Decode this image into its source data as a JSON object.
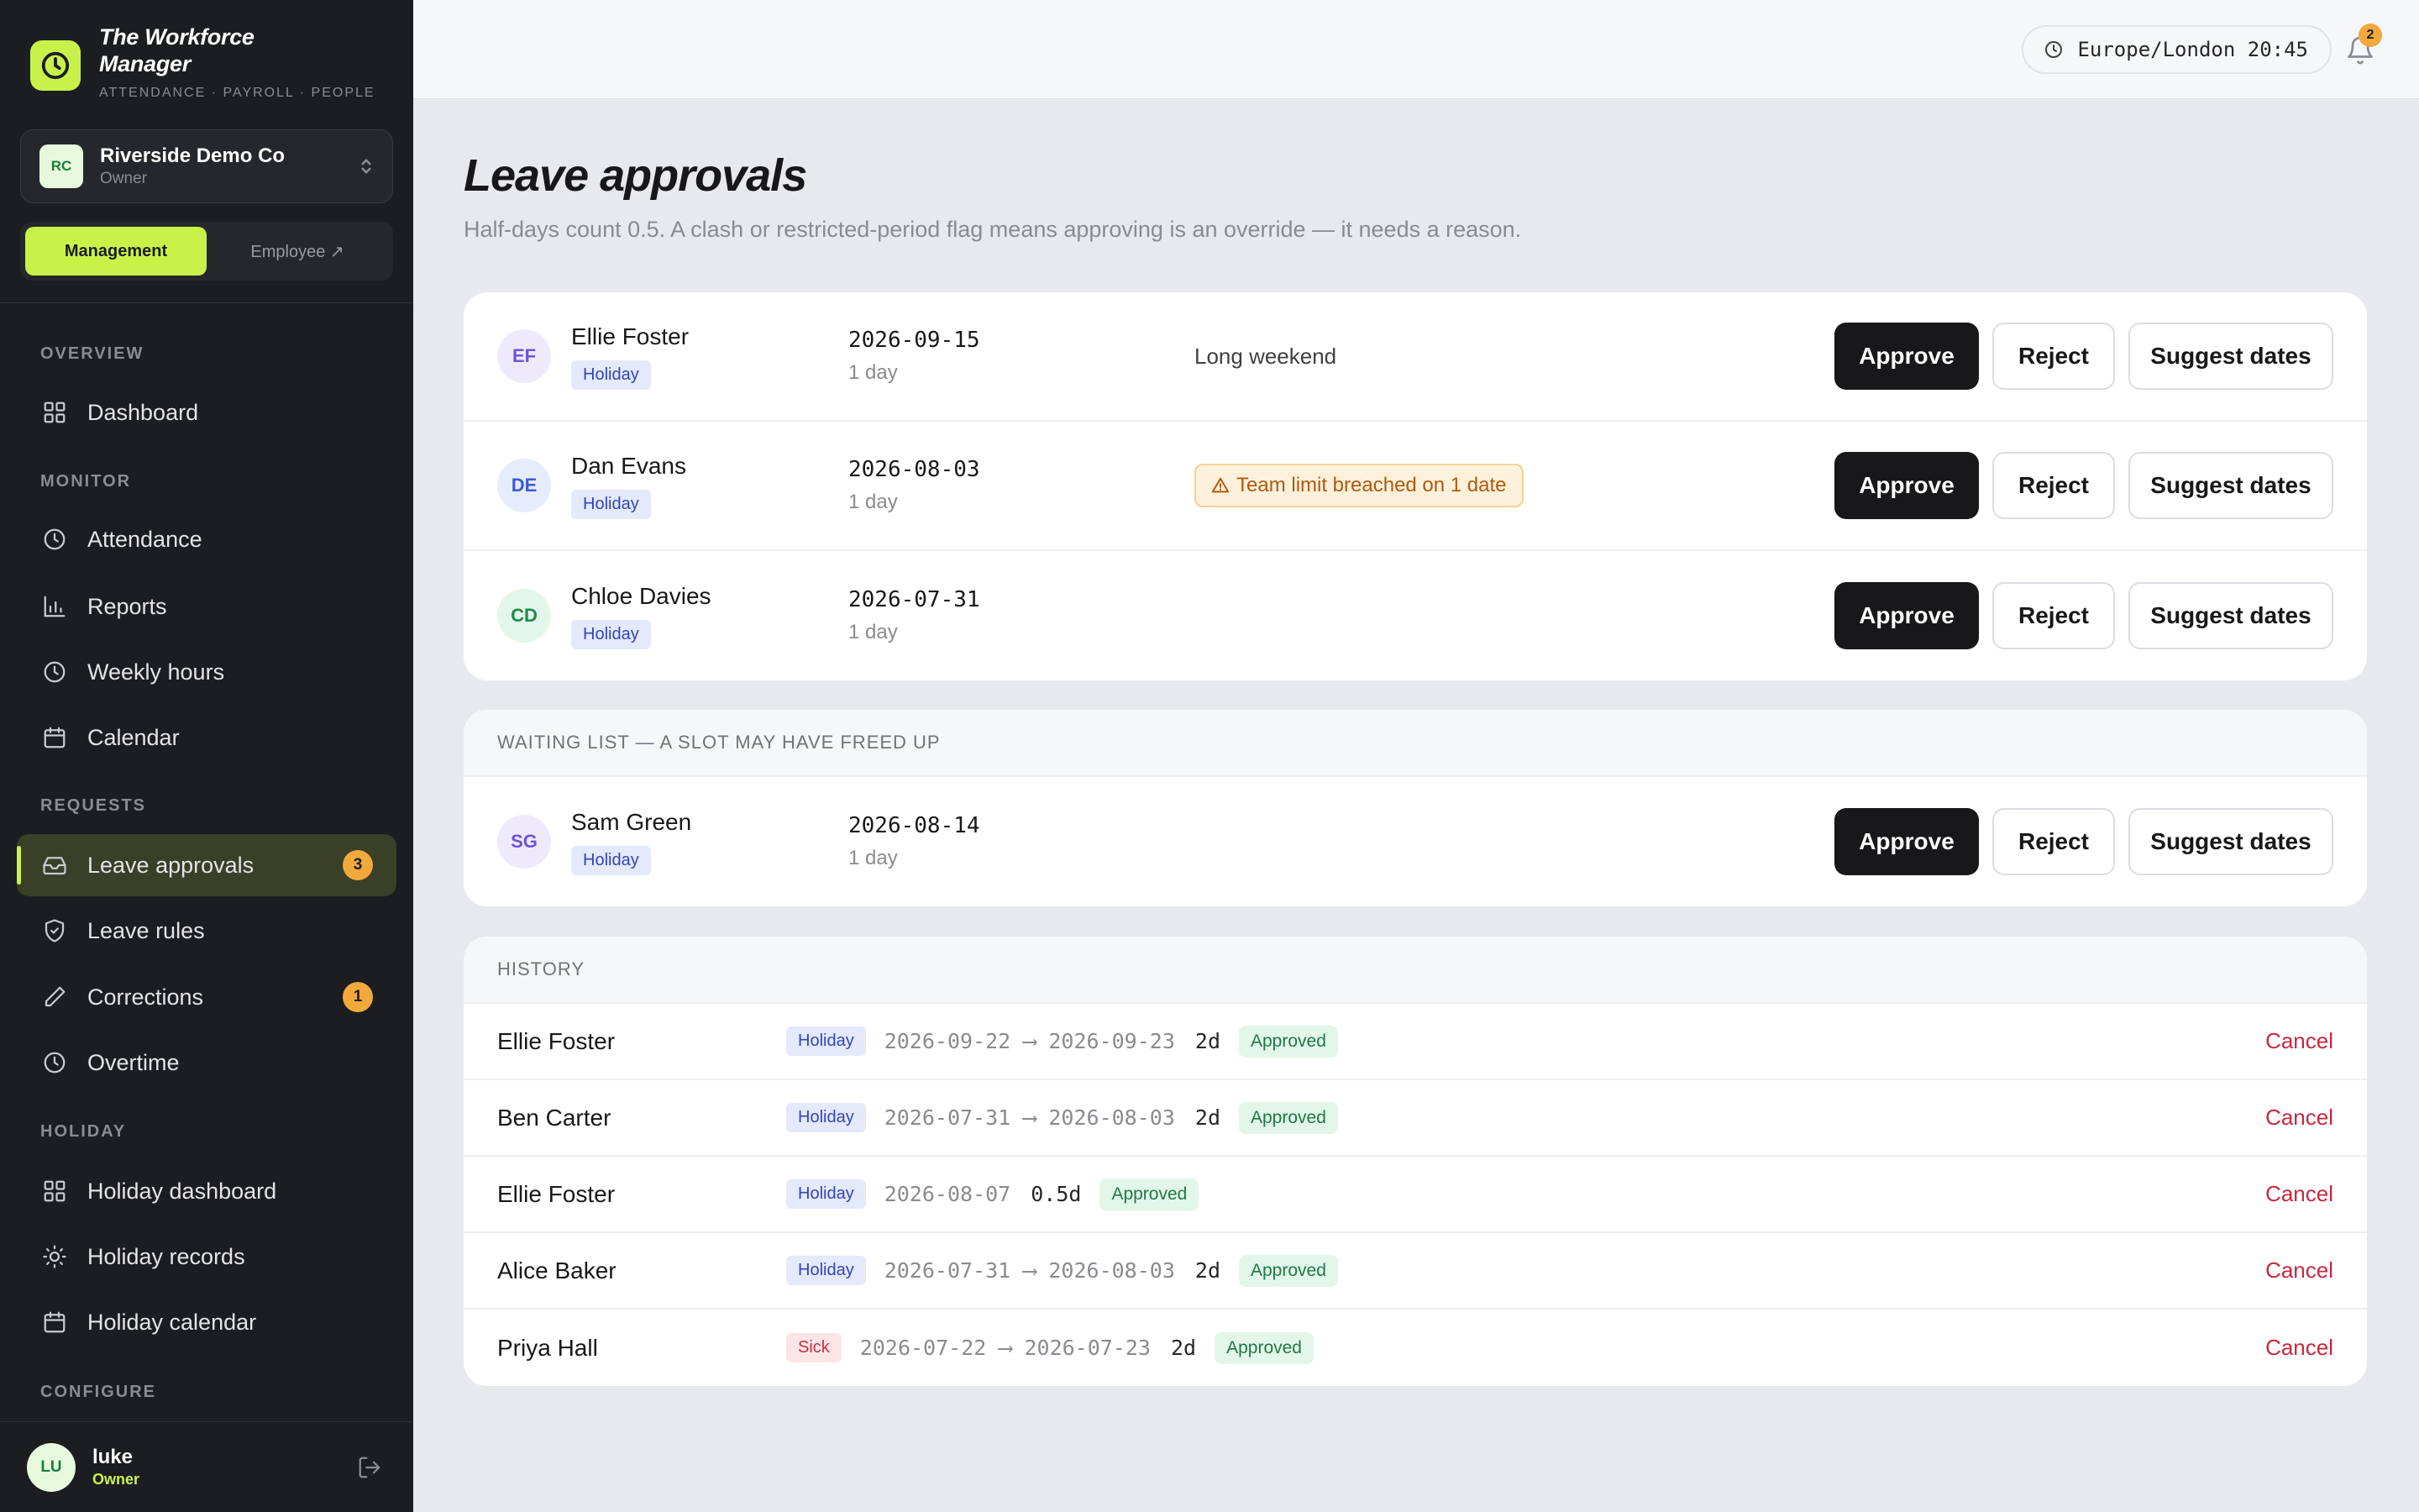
{
  "brand": {
    "title": "The Workforce Manager",
    "subtitle": "ATTENDANCE · PAYROLL · PEOPLE"
  },
  "org": {
    "initials": "RC",
    "name": "Riverside Demo Co",
    "role": "Owner"
  },
  "mode": {
    "management": "Management",
    "employee": "Employee ↗"
  },
  "nav": {
    "overview": "OVERVIEW",
    "monitor": "MONITOR",
    "requests": "REQUESTS",
    "holiday": "HOLIDAY",
    "configure": "CONFIGURE",
    "dashboard": "Dashboard",
    "attendance": "Attendance",
    "reports": "Reports",
    "weekly_hours": "Weekly hours",
    "calendar": "Calendar",
    "leave_approvals": "Leave approvals",
    "leave_approvals_badge": "3",
    "leave_rules": "Leave rules",
    "corrections": "Corrections",
    "corrections_badge": "1",
    "overtime": "Overtime",
    "holiday_dashboard": "Holiday dashboard",
    "holiday_records": "Holiday records",
    "holiday_calendar": "Holiday calendar"
  },
  "user": {
    "initials": "LU",
    "name": "luke",
    "role": "Owner"
  },
  "topbar": {
    "clock": "Europe/London 20:45",
    "notifications": "2"
  },
  "page": {
    "title": "Leave approvals",
    "subtitle": "Half-days count 0.5. A clash or restricted-period flag means approving is an override — it needs a reason."
  },
  "labels": {
    "approve": "Approve",
    "reject": "Reject",
    "suggest": "Suggest dates",
    "cancel": "Cancel"
  },
  "pending": [
    {
      "initials": "EF",
      "name": "Ellie Foster",
      "type": "Holiday",
      "date": "2026-09-15",
      "duration": "1 day",
      "note": "Long weekend",
      "warning": ""
    },
    {
      "initials": "DE",
      "name": "Dan Evans",
      "type": "Holiday",
      "date": "2026-08-03",
      "duration": "1 day",
      "note": "",
      "warning": "Team limit breached on 1 date"
    },
    {
      "initials": "CD",
      "name": "Chloe Davies",
      "type": "Holiday",
      "date": "2026-07-31",
      "duration": "1 day",
      "note": "",
      "warning": ""
    }
  ],
  "waiting": {
    "heading": "WAITING LIST — A SLOT MAY HAVE FREED UP",
    "items": [
      {
        "initials": "SG",
        "name": "Sam Green",
        "type": "Holiday",
        "date": "2026-08-14",
        "duration": "1 day"
      }
    ]
  },
  "history": {
    "heading": "HISTORY",
    "items": [
      {
        "name": "Ellie Foster",
        "type": "Holiday",
        "range": "2026-09-22 ⟶ 2026-09-23",
        "days": "2d",
        "status": "Approved"
      },
      {
        "name": "Ben Carter",
        "type": "Holiday",
        "range": "2026-07-31 ⟶ 2026-08-03",
        "days": "2d",
        "status": "Approved"
      },
      {
        "name": "Ellie Foster",
        "type": "Holiday",
        "range": "2026-08-07",
        "days": "0.5d",
        "status": "Approved"
      },
      {
        "name": "Alice Baker",
        "type": "Holiday",
        "range": "2026-07-31 ⟶ 2026-08-03",
        "days": "2d",
        "status": "Approved"
      },
      {
        "name": "Priya Hall",
        "type": "Sick",
        "range": "2026-07-22 ⟶ 2026-07-23",
        "days": "2d",
        "status": "Approved"
      }
    ]
  },
  "colors": {
    "accent": "#c8f24a",
    "sidebar": "#1c1d21",
    "badge": "#f2a93b",
    "danger": "#c8283f",
    "approved": "#1f7a45"
  }
}
